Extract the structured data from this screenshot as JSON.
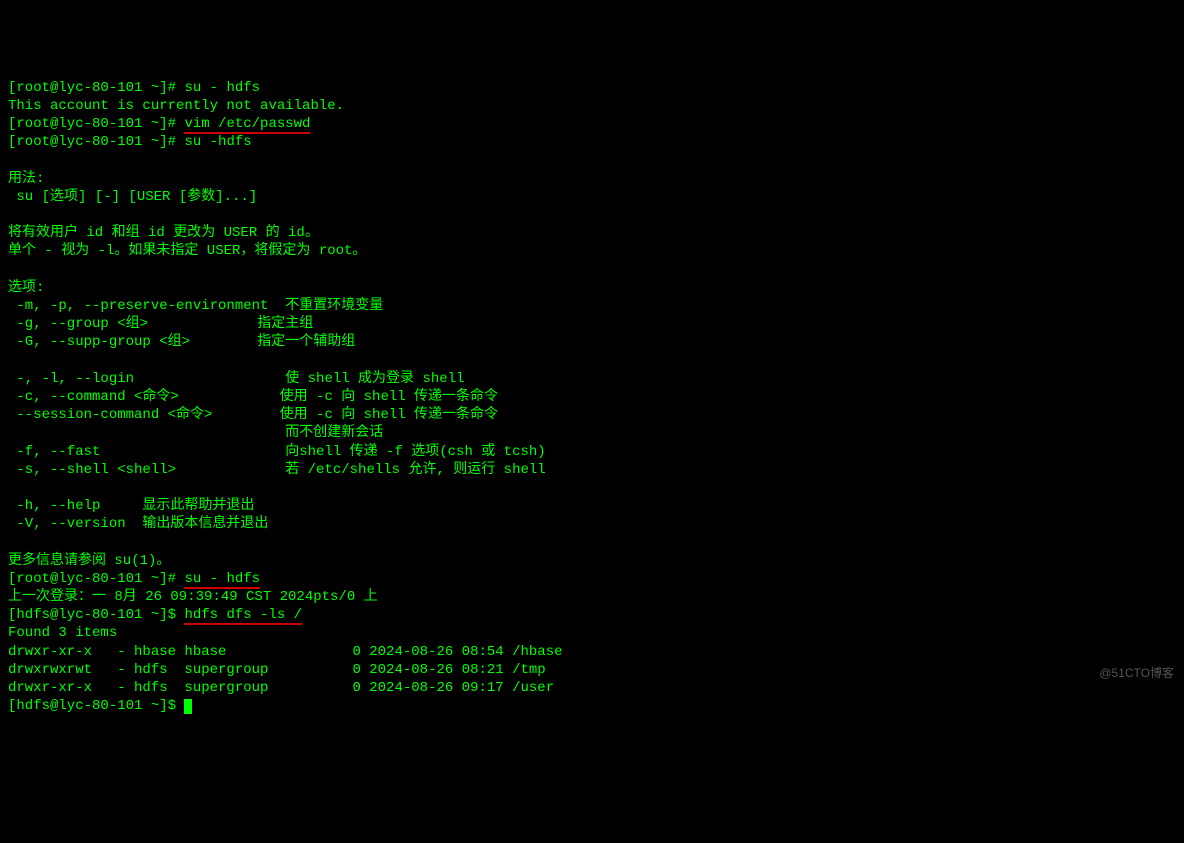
{
  "terminal": {
    "lines": [
      {
        "type": "prompt-cmd",
        "prompt": "[root@lyc-80-101 ~]# ",
        "cmd": "su - hdfs",
        "underline": false
      },
      {
        "type": "output",
        "text": "This account is currently not available."
      },
      {
        "type": "prompt-cmd",
        "prompt": "[root@lyc-80-101 ~]# ",
        "cmd": "vim /etc/passwd",
        "underline": true
      },
      {
        "type": "prompt-cmd",
        "prompt": "[root@lyc-80-101 ~]# ",
        "cmd": "su -hdfs",
        "underline": false
      },
      {
        "type": "output",
        "text": ""
      },
      {
        "type": "output",
        "text": "用法:"
      },
      {
        "type": "output",
        "text": " su [选项] [-] [USER [参数]...]"
      },
      {
        "type": "output",
        "text": ""
      },
      {
        "type": "output",
        "text": "将有效用户 id 和组 id 更改为 USER 的 id。"
      },
      {
        "type": "output",
        "text": "单个 - 视为 -l。如果未指定 USER，将假定为 root。"
      },
      {
        "type": "output",
        "text": ""
      },
      {
        "type": "output",
        "text": "选项:"
      },
      {
        "type": "output",
        "text": " -m, -p, --preserve-environment  不重置环境变量"
      },
      {
        "type": "output",
        "text": " -g, --group <组>             指定主组"
      },
      {
        "type": "output",
        "text": " -G, --supp-group <组>        指定一个辅助组"
      },
      {
        "type": "output",
        "text": ""
      },
      {
        "type": "output",
        "text": " -, -l, --login                  使 shell 成为登录 shell"
      },
      {
        "type": "output",
        "text": " -c, --command <命令>            使用 -c 向 shell 传递一条命令"
      },
      {
        "type": "output",
        "text": " --session-command <命令>        使用 -c 向 shell 传递一条命令"
      },
      {
        "type": "output",
        "text": "                                 而不创建新会话"
      },
      {
        "type": "output",
        "text": " -f, --fast                      向shell 传递 -f 选项(csh 或 tcsh)"
      },
      {
        "type": "output",
        "text": " -s, --shell <shell>             若 /etc/shells 允许, 则运行 shell"
      },
      {
        "type": "output",
        "text": ""
      },
      {
        "type": "output",
        "text": " -h, --help     显示此帮助并退出"
      },
      {
        "type": "output",
        "text": " -V, --version  输出版本信息并退出"
      },
      {
        "type": "output",
        "text": ""
      },
      {
        "type": "output",
        "text": "更多信息请参阅 su(1)。"
      },
      {
        "type": "prompt-cmd",
        "prompt": "[root@lyc-80-101 ~]# ",
        "cmd": "su - hdfs",
        "underline": true
      },
      {
        "type": "output",
        "text": "上一次登录：一 8月 26 09:39:49 CST 2024pts/0 上"
      },
      {
        "type": "prompt-cmd",
        "prompt": "[hdfs@lyc-80-101 ~]$ ",
        "cmd": "hdfs dfs -ls /",
        "underline": true
      },
      {
        "type": "output",
        "text": "Found 3 items"
      },
      {
        "type": "output",
        "text": "drwxr-xr-x   - hbase hbase               0 2024-08-26 08:54 /hbase"
      },
      {
        "type": "output",
        "text": "drwxrwxrwt   - hdfs  supergroup          0 2024-08-26 08:21 /tmp"
      },
      {
        "type": "output",
        "text": "drwxr-xr-x   - hdfs  supergroup          0 2024-08-26 09:17 /user"
      },
      {
        "type": "prompt-cursor",
        "prompt": "[hdfs@lyc-80-101 ~]$ "
      }
    ]
  },
  "watermark": "@51CTO博客"
}
